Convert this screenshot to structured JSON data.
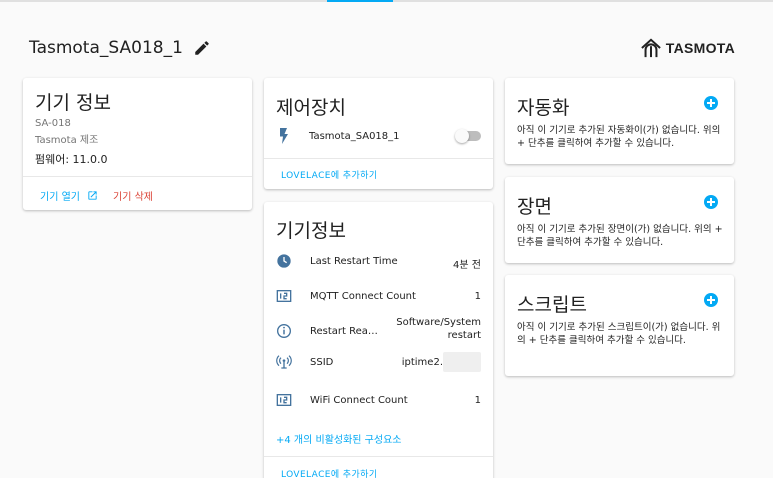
{
  "page": {
    "title": "Tasmota_SA018_1",
    "brand": "TASMOTA",
    "accent_color": "#03a9f4",
    "danger_color": "#db4437"
  },
  "device_info": {
    "title": "기기 정보",
    "model": "SA-018",
    "manufacturer": "Tasmota 제조",
    "firmware": "펌웨어: 11.0.0",
    "open_device_label": "기기 열기",
    "delete_device_label": "기기 삭제"
  },
  "controls": {
    "title": "제어장치",
    "entity_label": "Tasmota_SA018_1",
    "entity_icon": "flash-icon",
    "switch_state": "off",
    "lovelace_label": "LOVELACE에 추가하기"
  },
  "diagnostics": {
    "title": "기기정보",
    "rows": [
      {
        "icon": "clock-icon",
        "label": "Last Restart Time",
        "value": "4분 전"
      },
      {
        "icon": "counter-icon",
        "label": "MQTT Connect Count",
        "value": "1"
      },
      {
        "icon": "info-icon",
        "label": "Restart Rea…",
        "value": "Software/System restart"
      },
      {
        "icon": "wifi-antenna-icon",
        "label": "SSID",
        "value": "iptime2."
      },
      {
        "icon": "counter-icon",
        "label": "WiFi Connect Count",
        "value": "1"
      }
    ],
    "disabled_entities_label": "+4 개의 비활성화된 구성요소",
    "lovelace_label": "LOVELACE에 추가하기"
  },
  "automations": {
    "title": "자동화",
    "empty_text": "아직 이 기기로 추가된 자동화이(가) 없습니다. 위의 + 단추를 클릭하여 추가할 수 있습니다."
  },
  "scenes": {
    "title": "장면",
    "empty_text": "아직 이 기기로 추가된 장면이(가) 없습니다. 위의 + 단추를 클릭하여 추가할 수 있습니다."
  },
  "scripts": {
    "title": "스크립트",
    "empty_text": "아직 이 기기로 추가된 스크립트이(가) 없습니다. 위의 + 단추를 클릭하여 추가할 수 있습니다."
  }
}
